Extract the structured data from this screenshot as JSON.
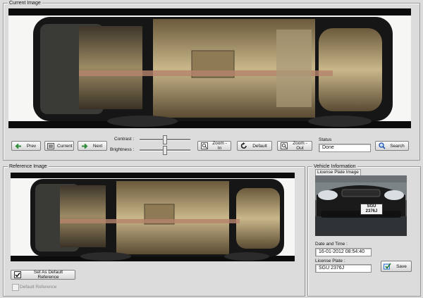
{
  "current": {
    "title": "Current Image"
  },
  "controls": {
    "prev": "Prev",
    "current": "Current",
    "next": "Next",
    "contrast": "Contrast :",
    "brightness": "Brightness :",
    "contrast_level": 0.5,
    "brightness_level": 0.5,
    "zoom_in": "Zoom - In",
    "default": "Default",
    "zoom_out": "Zoom - Out",
    "status_label": "Status",
    "status_value": "Done",
    "search": "Search"
  },
  "reference": {
    "title": "Reference Image",
    "set_default_label": "Set As Default Reference",
    "default_reference_label": "Default Reference"
  },
  "vehicle": {
    "title": "Vehicle Information",
    "plate_image_label": "License Plate Image",
    "plate_on_car": "SGU 2376J",
    "datetime_label": "Date and Time :",
    "datetime_value": "16-01-2012 08:54:40",
    "plate_label": "License Plate :",
    "plate_value": "SGU 2376J",
    "save": "Save"
  },
  "colors": {
    "panel": "#dcdcdc",
    "prev_icon": "#2e8b3a",
    "next_icon": "#2e8b3a",
    "search_icon": "#1a4fb0",
    "save_icon": "#2a6fd0"
  }
}
